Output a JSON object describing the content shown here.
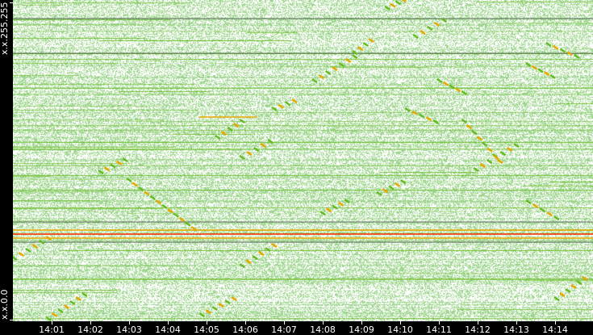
{
  "chart_data": {
    "type": "scatter",
    "title": "",
    "xlabel": "",
    "ylabel": "",
    "x_range_minutes": [
      0,
      15
    ],
    "x_origin": "14:00",
    "ylim": [
      0,
      65535
    ],
    "y_tick_labels": [
      "x.x.0.0",
      "x.x.255.255"
    ],
    "x_tick_labels": [
      "14:01",
      "14:02",
      "14:03",
      "14:04",
      "14:05",
      "14:06",
      "14:07",
      "14:08",
      "14:09",
      "14:10",
      "14:11",
      "14:12",
      "14:13",
      "14:14"
    ],
    "colors": {
      "background": "#ffffff",
      "low": "#9fd68f",
      "medium": "#66bb22",
      "high": "#e8a800",
      "peak": "#ff2a00",
      "dark_line": "#556655"
    },
    "horizontal_lines": [
      {
        "address": 61739,
        "t0": 0,
        "t1": 15,
        "level": "dark"
      },
      {
        "address": 54640,
        "t0": 0,
        "t1": 15,
        "level": "dark"
      },
      {
        "address": 41599,
        "t0": 4.8,
        "t1": 6.3,
        "level": "high"
      },
      {
        "address": 20139,
        "t0": 0,
        "t1": 15,
        "level": "dark"
      },
      {
        "address": 18488,
        "t0": 0,
        "t1": 15,
        "level": "high"
      },
      {
        "address": 17663,
        "t0": 0,
        "t1": 15,
        "level": "peak"
      },
      {
        "address": 16838,
        "t0": 0,
        "t1": 15,
        "level": "high"
      },
      {
        "address": 16012,
        "t0": 0,
        "t1": 15,
        "level": "dark"
      }
    ],
    "scan_streaks": [
      {
        "t0": 0.04,
        "a0": 12710,
        "t1": 0.92,
        "a1": 16840
      },
      {
        "t0": 0.92,
        "a0": 330,
        "t1": 1.85,
        "a1": 5280
      },
      {
        "t0": 2.27,
        "a0": 30370,
        "t1": 2.9,
        "a1": 32840
      },
      {
        "t0": 3.0,
        "a0": 28720,
        "t1": 4.67,
        "a1": 18820
      },
      {
        "t0": 5.29,
        "a0": 37470,
        "t1": 5.92,
        "a1": 40770
      },
      {
        "t0": 5.92,
        "a0": 33340,
        "t1": 6.65,
        "a1": 36640
      },
      {
        "t0": 6.75,
        "a0": 43250,
        "t1": 7.27,
        "a1": 44900
      },
      {
        "t0": 7.79,
        "a0": 49030,
        "t1": 8.83,
        "a1": 53980
      },
      {
        "t0": 8.83,
        "a0": 54800,
        "t1": 9.25,
        "a1": 57280
      },
      {
        "t0": 9.67,
        "a0": 63890,
        "t1": 10.08,
        "a1": 65535
      },
      {
        "t0": 10.4,
        "a0": 58110,
        "t1": 11.13,
        "a1": 61410
      },
      {
        "t0": 10.19,
        "a0": 43090,
        "t1": 10.92,
        "a1": 40610
      },
      {
        "t0": 11.02,
        "a0": 49030,
        "t1": 11.65,
        "a1": 46560
      },
      {
        "t0": 11.65,
        "a0": 40770,
        "t1": 12.58,
        "a1": 32510
      },
      {
        "t0": 11.96,
        "a0": 30860,
        "t1": 13.0,
        "a1": 35810
      },
      {
        "t0": 13.31,
        "a0": 24260,
        "t1": 14.04,
        "a1": 20960
      },
      {
        "t0": 13.83,
        "a0": 56460,
        "t1": 14.56,
        "a1": 53980
      },
      {
        "t0": 13.31,
        "a0": 52330,
        "t1": 13.94,
        "a1": 49860
      },
      {
        "t0": 9.46,
        "a0": 25910,
        "t1": 10.08,
        "a1": 28390
      },
      {
        "t0": 8.0,
        "a0": 21950,
        "t1": 8.63,
        "a1": 24420
      },
      {
        "t0": 5.92,
        "a0": 11220,
        "t1": 6.75,
        "a1": 15340
      },
      {
        "t0": 4.88,
        "a0": 1150,
        "t1": 5.71,
        "a1": 4450
      },
      {
        "t0": 14.04,
        "a0": 4450,
        "t1": 14.77,
        "a1": 8580
      }
    ]
  }
}
